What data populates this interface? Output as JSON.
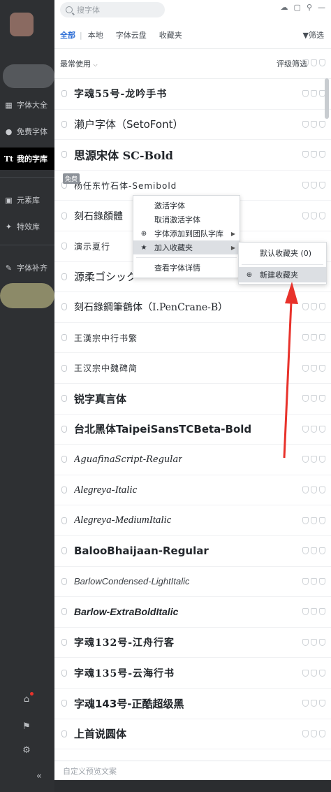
{
  "sidebar": {
    "items": [
      {
        "label": "字体大全",
        "icon": "grid-icon"
      },
      {
        "label": "免费字体",
        "icon": "coin-icon"
      },
      {
        "label": "我的字库",
        "icon": "tt-icon",
        "active": true
      },
      {
        "label": "元素库",
        "icon": "image-icon"
      },
      {
        "label": "特效库",
        "icon": "sparkle-icon"
      },
      {
        "label": "字体补齐",
        "icon": "wrench-icon"
      }
    ],
    "bottom_icons": [
      "gift-icon",
      "flag-icon",
      "gear-icon",
      "collapse-icon"
    ]
  },
  "search": {
    "placeholder": "搜字体"
  },
  "tabs": [
    "全部",
    "本地",
    "字体云盘",
    "收藏夹"
  ],
  "active_tab": "全部",
  "filter_label": "筛选",
  "sort_label": "最常使用",
  "rating_label": "评级筛选",
  "free_badge": "免费",
  "fonts": [
    {
      "name": "字魂55号-龙吟手书",
      "style": "brush"
    },
    {
      "name": "濑户字体（SetoFont）",
      "style": "normal"
    },
    {
      "name": "思源宋体 SC-Bold",
      "style": "serif-bold"
    },
    {
      "name": "杨任东竹石体-Semibold",
      "style": "light"
    },
    {
      "name": "刻石錄顏體",
      "style": "serif"
    },
    {
      "name": "演示夏行",
      "style": "light"
    },
    {
      "name": "源柔ゴシック",
      "style": "normal"
    },
    {
      "name": "刻石錄鋼筆鶴体（I.PenCrane-B）",
      "style": "serif"
    },
    {
      "name": "王漢宗中行书繁",
      "style": "light"
    },
    {
      "name": "王汉宗中魏碑简",
      "style": "light"
    },
    {
      "name": "锐字真言体",
      "style": "bold"
    },
    {
      "name": "台北黑体TaipeiSansTCBeta-Bold",
      "style": "bold"
    },
    {
      "name": "AguafinaScript-Regular",
      "style": "script"
    },
    {
      "name": "Alegreya-Italic",
      "style": "italic-serif"
    },
    {
      "name": "Alegreya-MediumItalic",
      "style": "italic-serif"
    },
    {
      "name": "BalooBhaijaan-Regular",
      "style": "bold"
    },
    {
      "name": "BarlowCondensed-LightItalic",
      "style": "italic-light"
    },
    {
      "name": "Barlow-ExtraBoldItalic",
      "style": "italic-bold"
    },
    {
      "name": "字魂132号-江舟行客",
      "style": "brush"
    },
    {
      "name": "字魂135号-云海行书",
      "style": "brush"
    },
    {
      "name": "字魂143号-正酷超级黑",
      "style": "bold"
    },
    {
      "name": "上首说圆体",
      "style": "bold"
    }
  ],
  "context_menu": {
    "items": [
      "激活字体",
      "取消激活字体",
      "字体添加到团队字库",
      "加入收藏夹",
      "查看字体详情"
    ],
    "highlighted": "加入收藏夹"
  },
  "submenu": {
    "items": [
      "默认收藏夹 (0)",
      "新建收藏夹"
    ],
    "highlighted": "新建收藏夹"
  },
  "preview_placeholder": "自定义预览文案",
  "colors": {
    "accent": "#2f6fd6",
    "arrow": "#e8322b",
    "sidebar_bg": "#2e3033"
  }
}
